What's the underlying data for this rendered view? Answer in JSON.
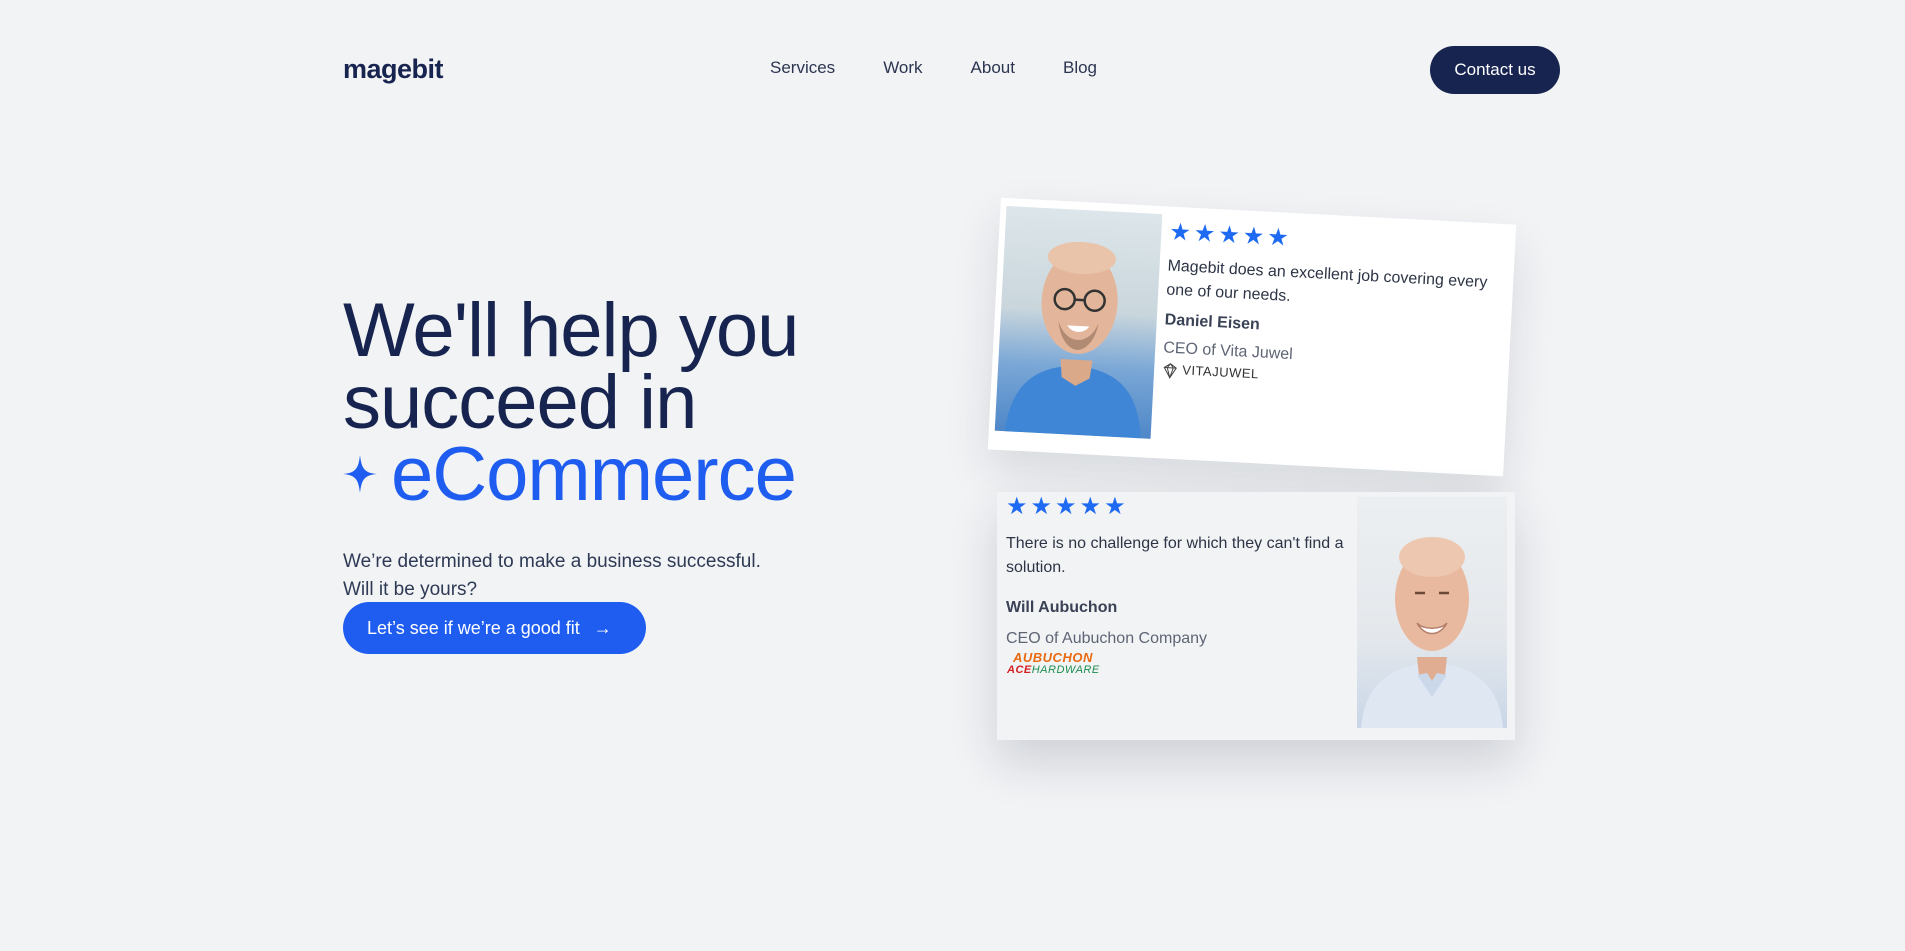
{
  "header": {
    "logo": "magebit",
    "nav": [
      "Services",
      "Work",
      "About",
      "Blog"
    ],
    "contact_label": "Contact us"
  },
  "hero": {
    "title_line1": "We'll help you",
    "title_line2": "succeed in",
    "title_accent": "eCommerce",
    "subtitle": "We’re determined to make a business successful. Will it be yours?",
    "cta_label": "Let’s see if we’re a good fit",
    "cta_arrow": "→"
  },
  "testimonials": [
    {
      "rating": 5,
      "quote": "Magebit does an excellent job covering every one of our needs.",
      "name": "Daniel Eisen",
      "role": "CEO of Vita Juwel",
      "brand": "VITAJUWEL"
    },
    {
      "rating": 5,
      "quote": "There is no challenge for which they can't find a solution.",
      "name": "Will Aubuchon",
      "role": "CEO of Aubuchon Company",
      "brand_top": "AUBUCHON",
      "brand_ace": "ACE",
      "brand_bottom": "HARDWARE"
    }
  ],
  "colors": {
    "navy": "#16244f",
    "accent": "#1e5df0",
    "star": "#1e6af2",
    "background": "#f2f3f5"
  }
}
